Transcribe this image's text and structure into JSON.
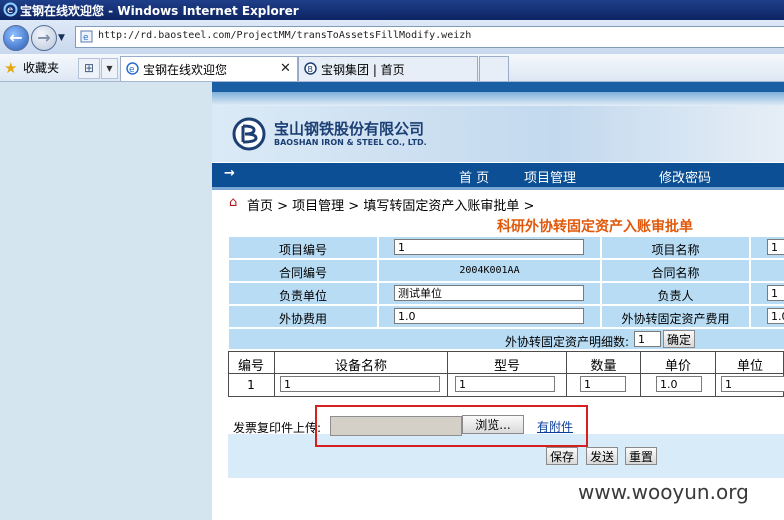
{
  "window": {
    "title": "宝钢在线欢迎您 - Windows Internet Explorer"
  },
  "address": {
    "url": "http://rd.baosteel.com/ProjectMM/transToAssetsFillModify.weizh"
  },
  "favorites": {
    "label": "收藏夹"
  },
  "tabs": [
    {
      "label": "宝钢在线欢迎您"
    },
    {
      "label": "宝钢集团 | 首页"
    }
  ],
  "company": {
    "name_cn": "宝山钢铁股份有限公司",
    "name_en": "BAOSHAN IRON & STEEL CO., LTD."
  },
  "menu": {
    "arrow": "→",
    "items": [
      "首 页",
      "项目管理",
      "修改密码"
    ]
  },
  "breadcrumb": {
    "text": "首页 > 项目管理 > 填写转固定资产入账审批单 >"
  },
  "page_title": "科研外协转固定资产入账审批单",
  "form": {
    "project_no_label": "项目编号",
    "project_no_value": "1",
    "project_name_label": "项目名称",
    "project_name_value": "1",
    "contract_no_label": "合同编号",
    "contract_no_value": "2004K001AA",
    "contract_name_label": "合同名称",
    "dept_label": "负责单位",
    "dept_value": "测试单位",
    "person_label": "负责人",
    "person_value": "1",
    "outsource_fee_label": "外协费用",
    "outsource_fee_value": "1.0",
    "asset_fee_label": "外协转固定资产费用",
    "asset_fee_value": "1.0",
    "detail_count_label": "外协转固定资产明细数:",
    "detail_count_value": "1",
    "confirm_button": "确定"
  },
  "equipment": {
    "headers": [
      "编号",
      "设备名称",
      "型号",
      "数量",
      "单价",
      "单位"
    ],
    "rows": [
      {
        "no": "1",
        "name": "1",
        "model": "1",
        "qty": "1",
        "price": "1.0",
        "unit": "1"
      }
    ]
  },
  "upload": {
    "label": "发票复印件上传:",
    "browse_button": "浏览...",
    "attachment_link": "有附件"
  },
  "actions": {
    "save": "保存",
    "send": "发送",
    "reset": "重置"
  },
  "watermark": "www.wooyun.org",
  "colors": {
    "menu_bg": "#0d4f94",
    "cell_bg": "#b9dcf5",
    "title_orange": "#e0580a",
    "highlight_red": "#d62020"
  }
}
